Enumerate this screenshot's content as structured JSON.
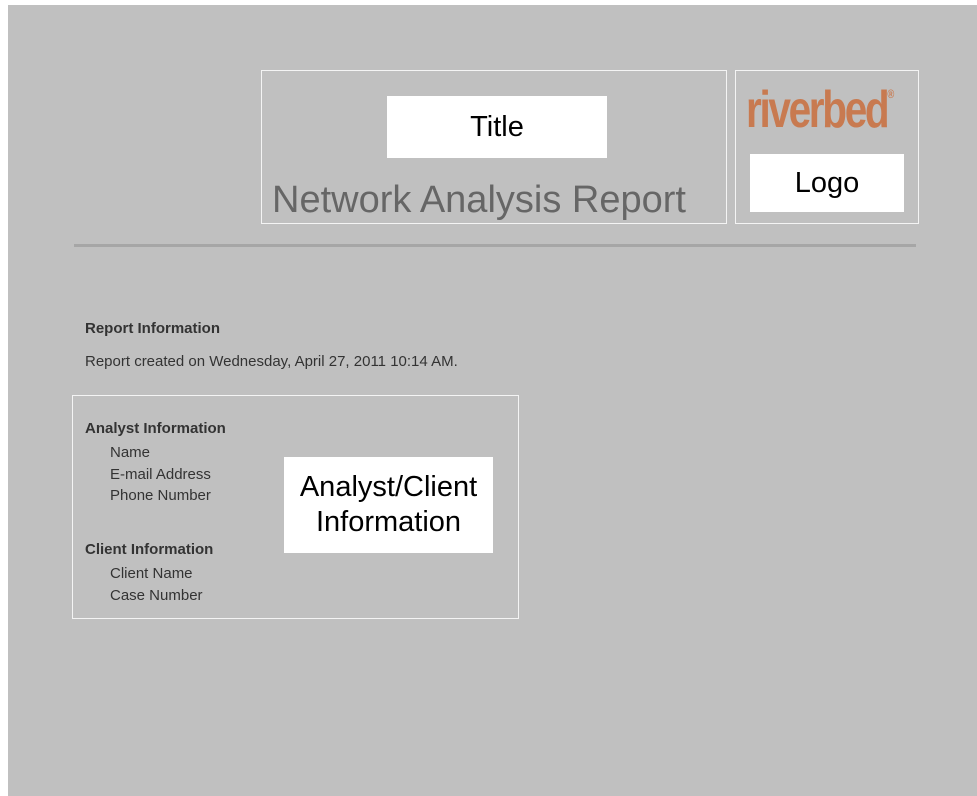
{
  "title_placeholder": "Title",
  "report_title": "Network Analysis Report",
  "logo": {
    "brand_text": "riverbed",
    "registered_mark": "®",
    "placeholder": "Logo"
  },
  "report_info": {
    "heading": "Report Information",
    "created_text": "Report created on Wednesday, April 27, 2011 10:14 AM."
  },
  "analyst": {
    "heading": "Analyst Information",
    "fields": [
      "Name",
      "E-mail Address",
      "Phone Number"
    ]
  },
  "client": {
    "heading": "Client Information",
    "fields": [
      "Client Name",
      "Case Number"
    ]
  },
  "info_placeholder": {
    "line1": "Analyst/Client",
    "line2": "Information"
  },
  "colors": {
    "background": "#c0c0c0",
    "brand": "#c87a50",
    "title_text": "#666666",
    "body_text": "#333333",
    "divider": "#a6a6a6"
  }
}
